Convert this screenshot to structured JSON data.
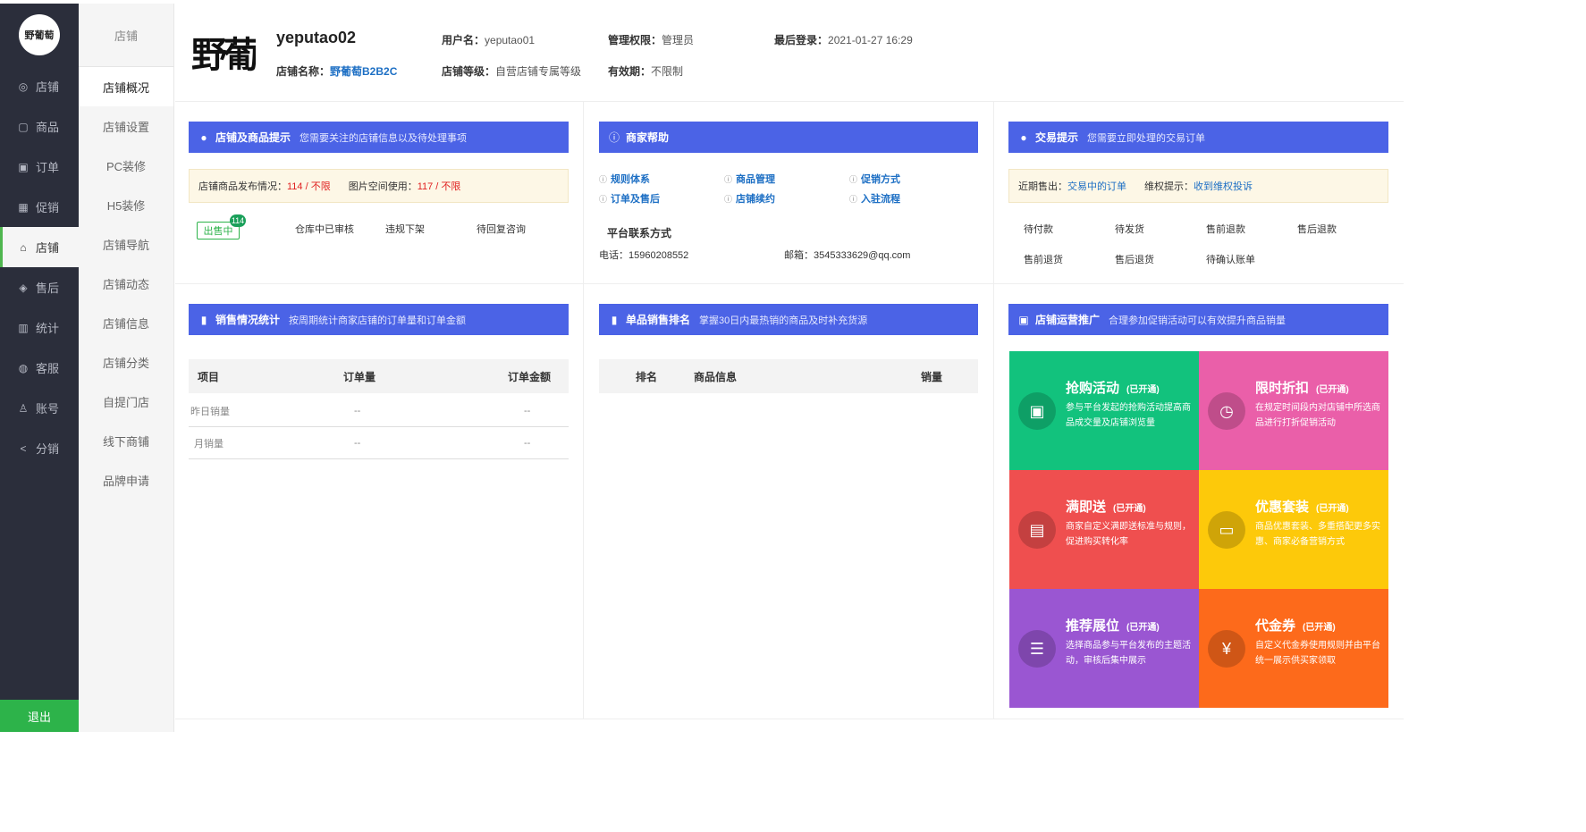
{
  "sidebar": {
    "logo_text": "野葡萄",
    "items": [
      {
        "label": "店铺",
        "icon": "eye-icon",
        "glyph": "◎"
      },
      {
        "label": "商品",
        "icon": "bag-icon",
        "glyph": "▢"
      },
      {
        "label": "订单",
        "icon": "order-icon",
        "glyph": "▣"
      },
      {
        "label": "促销",
        "icon": "gift-icon",
        "glyph": "▦"
      },
      {
        "label": "店铺",
        "icon": "store-icon",
        "glyph": "⌂"
      },
      {
        "label": "售后",
        "icon": "shield-icon",
        "glyph": "◈"
      },
      {
        "label": "统计",
        "icon": "chart-icon",
        "glyph": "▥"
      },
      {
        "label": "客服",
        "icon": "service-icon",
        "glyph": "◍"
      },
      {
        "label": "账号",
        "icon": "user-icon",
        "glyph": "♙"
      },
      {
        "label": "分销",
        "icon": "share-icon",
        "glyph": "<"
      }
    ],
    "logout_label": "退出"
  },
  "submenu": {
    "title": "店铺",
    "items": [
      "店铺概况",
      "店铺设置",
      "PC装修",
      "H5装修",
      "店铺导航",
      "店铺动态",
      "店铺信息",
      "店铺分类",
      "自提门店",
      "线下商铺",
      "品牌申请"
    ]
  },
  "header": {
    "logo_text": "野葡",
    "store_id": "yeputao02",
    "username_label": "用户名：",
    "username": "yeputao01",
    "role_label": "管理权限：",
    "role": "管理员",
    "last_login_label": "最后登录：",
    "last_login": "2021-01-27 16:29",
    "store_name_label": "店铺名称：",
    "store_name": "野葡萄B2B2C",
    "store_level_label": "店铺等级：",
    "store_level": "自营店铺专属等级",
    "validity_label": "有效期：",
    "validity": "不限制"
  },
  "panel_goods": {
    "title": "店铺及商品提示",
    "desc": "您需要关注的店铺信息以及待处理事项",
    "publish_label": "店铺商品发布情况：",
    "publish_value": "114 /  不限",
    "space_label": "图片空间使用：",
    "space_value": "117 / 不限",
    "on_sale_label": "出售中",
    "on_sale_count": "114",
    "status_items": [
      "仓库中已审核",
      "违规下架",
      "待回复咨询"
    ]
  },
  "panel_help": {
    "title": "商家帮助",
    "links": [
      "规则体系",
      "商品管理",
      "促销方式",
      "订单及售后",
      "店铺续约",
      "入驻流程"
    ],
    "contact_title": "平台联系方式",
    "phone_label": "电话：",
    "phone": "15960208552",
    "email_label": "邮箱：",
    "email": "3545333629@qq.com"
  },
  "panel_trade": {
    "title": "交易提示",
    "desc": "您需要立即处理的交易订单",
    "recent_label": "近期售出：",
    "recent_link": "交易中的订单",
    "rights_label": "维权提示：",
    "rights_link": "收到维权投诉",
    "items": [
      "待付款",
      "待发货",
      "售前退款",
      "售后退款",
      "售前退货",
      "售后退货",
      "待确认账单"
    ]
  },
  "panel_sales": {
    "title": "销售情况统计",
    "desc": "按周期统计商家店铺的订单量和订单金额",
    "columns": [
      "项目",
      "订单量",
      "订单金额"
    ],
    "rows": [
      {
        "item": "昨日销量",
        "orders": "--",
        "amount": "--"
      },
      {
        "item": "月销量",
        "orders": "--",
        "amount": "--"
      }
    ]
  },
  "panel_rank": {
    "title": "单品销售排名",
    "desc": "掌握30日内最热销的商品及时补充货源",
    "columns": [
      "排名",
      "商品信息",
      "销量"
    ]
  },
  "panel_promo": {
    "title": "店铺运营推广",
    "desc": "合理参加促销活动可以有效提升商品销量",
    "tiles": [
      {
        "name": "抢购活动",
        "status": "(已开通)",
        "desc": "参与平台发起的抢购活动提高商品成交量及店铺浏览量",
        "color": "#12c27d",
        "icon": "shopping-bag-icon",
        "glyph": "▣"
      },
      {
        "name": "限时折扣",
        "status": "(已开通)",
        "desc": "在规定时间段内对店铺中所选商品进行打折促销活动",
        "color": "#ea5fa9",
        "icon": "clock-icon",
        "glyph": "◷"
      },
      {
        "name": "满即送",
        "status": "(已开通)",
        "desc": "商家自定义满即送标准与规则，促进购买转化率",
        "color": "#ef4f4f",
        "icon": "gift-box-icon",
        "glyph": "▤"
      },
      {
        "name": "优惠套装",
        "status": "(已开通)",
        "desc": "商品优惠套装、多重搭配更多实惠、商家必备营销方式",
        "color": "#fdc90a",
        "icon": "card-icon",
        "glyph": "▭"
      },
      {
        "name": "推荐展位",
        "status": "(已开通)",
        "desc": "选择商品参与平台发布的主题活动，审核后集中展示",
        "color": "#9a56d2",
        "icon": "list-icon",
        "glyph": "☰"
      },
      {
        "name": "代金券",
        "status": "(已开通)",
        "desc": "自定义代金券使用规则并由平台统一展示供买家领取",
        "color": "#fd6a1b",
        "icon": "yen-icon",
        "glyph": "¥"
      }
    ]
  }
}
